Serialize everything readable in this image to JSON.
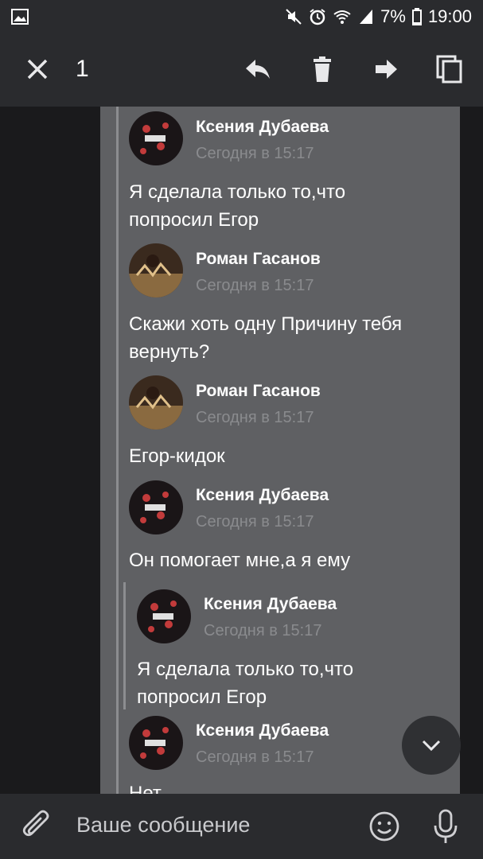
{
  "status_bar": {
    "battery": "7%",
    "time": "19:00"
  },
  "toolbar": {
    "selected_count": "1"
  },
  "messages": [
    {
      "author": "Ксения Дубаева",
      "time": "Сегодня в 15:17",
      "text": "Я сделала только то,что попросил Егор"
    },
    {
      "author": "Роман Гасанов",
      "time": "Сегодня в 15:17",
      "text": "Скажи хоть одну Причину тебя вернуть?"
    },
    {
      "author": "Роман Гасанов",
      "time": "Сегодня в 15:17",
      "text": "Егор-кидок"
    },
    {
      "author": "Ксения Дубаева",
      "time": "Сегодня в 15:17",
      "text": "Он помогает мне,а я ему"
    },
    {
      "author": "Ксения Дубаева",
      "time": "Сегодня в 15:17",
      "text": "Я сделала только то,что попросил Егор"
    },
    {
      "author": "Ксения Дубаева",
      "time": "Сегодня в 15:17",
      "text": "Нет"
    }
  ],
  "composer": {
    "placeholder": "Ваше сообщение"
  },
  "colors": {
    "bar_bg": "#2a2b2e",
    "selected_bg": "#5f6063",
    "time_text": "#8a8b8e"
  }
}
